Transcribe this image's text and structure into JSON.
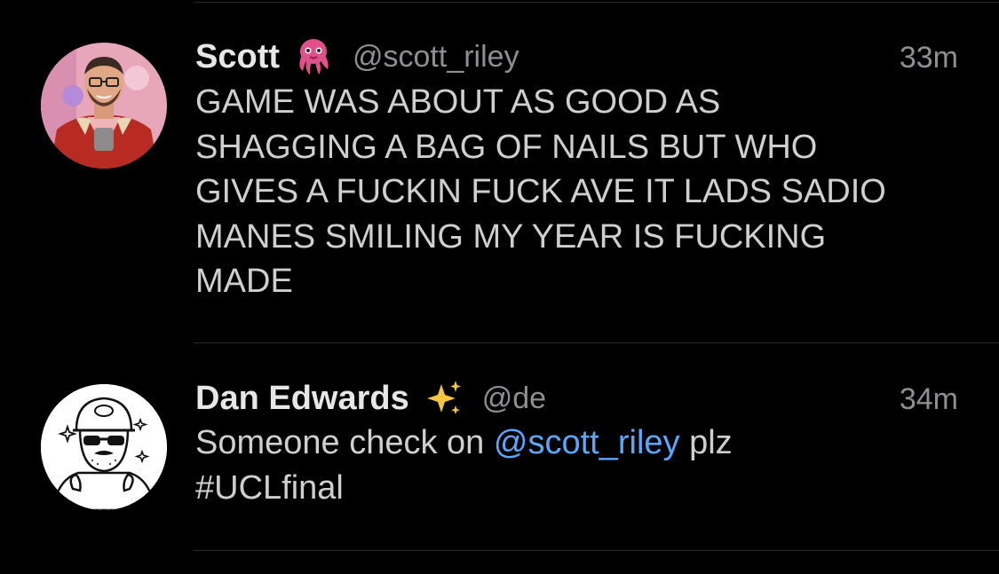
{
  "tweets": [
    {
      "name": "Scott",
      "name_emoji": "octopus-emoji",
      "handle": "@scott_riley",
      "time": "33m",
      "body_lines": [
        "GAME WAS ABOUT AS GOOD AS",
        "SHAGGING A BAG OF NAILS BUT WHO",
        "GIVES A FUCKIN FUCK AVE IT LADS SADIO",
        "MANES SMILING MY YEAR IS FUCKING",
        "MADE"
      ]
    },
    {
      "name": "Dan Edwards",
      "name_emoji": "sparkles-emoji",
      "handle": "@de",
      "time": "34m",
      "body_line1_before": "Someone check on ",
      "body_line1_mention": "@scott_riley",
      "body_line1_after": " plz",
      "body_line2": "#UCLfinal"
    }
  ],
  "colors": {
    "background": "#000000",
    "mention": "#5aa7ff",
    "muted": "#8e8e93",
    "divider": "#2a2a2d"
  }
}
